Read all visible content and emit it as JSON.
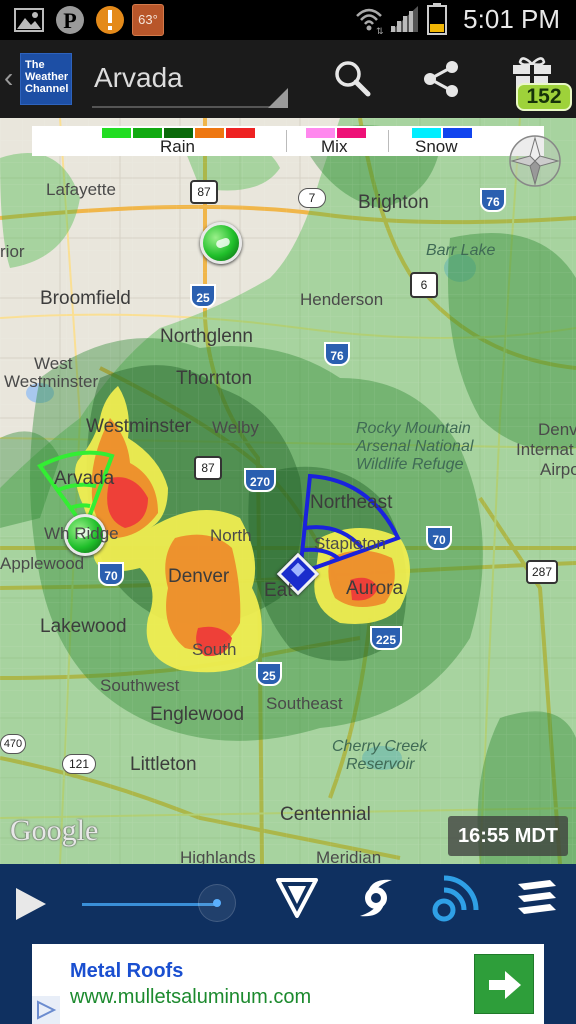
{
  "status_bar": {
    "time": "5:01 PM",
    "temperature": "63°",
    "icons": [
      "gallery-icon",
      "pinterest-icon",
      "alert-icon",
      "temperature-badge",
      "wifi-icon",
      "signal-icon",
      "battery-icon"
    ]
  },
  "app_bar": {
    "logo_lines": [
      "The",
      "Weather",
      "Channel"
    ],
    "location": "Arvada",
    "badge_count": "152",
    "icons": [
      "back-chevron-icon",
      "search-icon",
      "share-icon",
      "gift-icon"
    ]
  },
  "map": {
    "legend": {
      "rain_label": "Rain",
      "mix_label": "Mix",
      "snow_label": "Snow",
      "rain_colors": [
        "#22dd22",
        "#11aa11",
        "#0a6a0a",
        "#ee7711",
        "#ee2222"
      ],
      "mix_colors": [
        "#ff88ee",
        "#ee1177"
      ],
      "snow_colors": [
        "#00eeff",
        "#1144ee"
      ]
    },
    "labels": {
      "lafayette": "Lafayette",
      "brighton": "Brighton",
      "barr_lake": "Barr Lake",
      "rior": "rior",
      "broomfield": "Broomfield",
      "henderson": "Henderson",
      "northglenn": "Northglenn",
      "thornton": "Thornton",
      "west_westminster_1": "West",
      "west_westminster_2": "Westminster",
      "westminster": "Westminster",
      "welby": "Welby",
      "rocky_1": "Rocky Mountain",
      "rocky_2": "Arsenal National",
      "rocky_3": "Wildlife Refuge",
      "denver_intl_1": "Denv",
      "denver_intl_2": "Internat",
      "denver_intl_3": "Airpo",
      "arvada": "Arvada",
      "wheat_ridge": "Wh  Ridge",
      "northeast": "Northeast",
      "north": "North",
      "stapleton": "Stapleton",
      "applewood": "Applewood",
      "denver": "Denver",
      "east": "Eat",
      "aurora": "Aurora",
      "lakewood": "Lakewood",
      "south": "South",
      "southwest": "Southwest",
      "southeast": "Southeast",
      "englewood": "Englewood",
      "cherry_creek_1": "Cherry Creek",
      "cherry_creek_2": "Reservoir",
      "littleton": "Littleton",
      "centennial": "Centennial",
      "highlands": "Highlands",
      "meridian": "Meridian"
    },
    "shields": {
      "i76_top": "76",
      "us87_top": "87",
      "r7": "7",
      "i25_top": "25",
      "us6": "6",
      "i76_mid": "76",
      "us87_mid": "87",
      "i270": "270",
      "r70_left": "70",
      "i70": "70",
      "r287": "287",
      "i225": "225",
      "i25_mid": "25",
      "c470": "470",
      "r121": "121"
    },
    "timestamp": "16:55 MDT",
    "attribution": "Google"
  },
  "controls": {
    "slider_position": 0.9,
    "icons": [
      "play-icon",
      "timeline-slider",
      "radar-filter-icon",
      "hurricane-icon",
      "signal-waves-icon",
      "layers-icon"
    ]
  },
  "ad": {
    "title": "Metal Roofs",
    "url": "www.mulletsaluminum.com",
    "icons": [
      "arrow-right-icon",
      "adchoices-icon"
    ]
  }
}
